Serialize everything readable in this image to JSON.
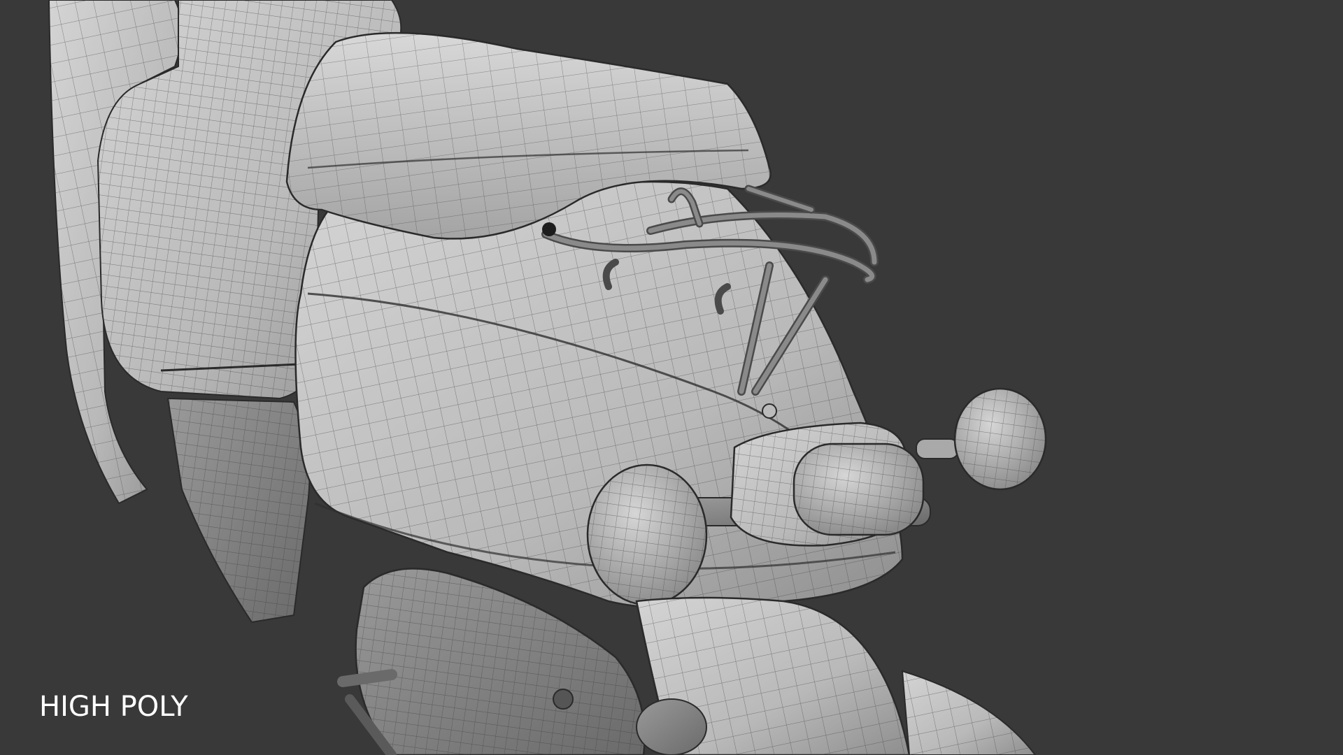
{
  "caption": "HIGH POLY",
  "colors": {
    "background": "#393939",
    "surface_light": "#c9c9c9",
    "surface_mid": "#a9a9a9",
    "surface_dark": "#6e6e6e",
    "wire": "#2a2a2a",
    "caption_text": "#ffffff"
  },
  "icons": {
    "main_subject": "scooter-high-poly-wireframe"
  }
}
